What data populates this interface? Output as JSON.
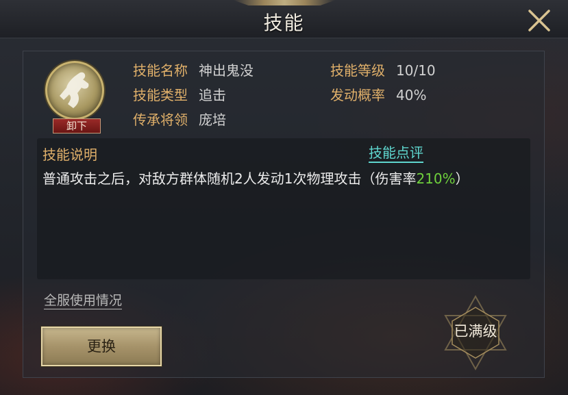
{
  "window": {
    "title": "技能"
  },
  "skill": {
    "unequip_label": "卸下",
    "name_label": "技能名称",
    "name_value": "神出鬼没",
    "type_label": "技能类型",
    "type_value": "追击",
    "inherit_label": "传承将领",
    "inherit_value": "庞培",
    "level_label": "技能等级",
    "level_value": "10/10",
    "rate_label": "发动概率",
    "rate_value": "40%"
  },
  "description": {
    "title": "技能说明",
    "review_link": "技能点评",
    "text_main": "普通攻击之后，对敌方群体随机2人发动1次物理攻击（伤害率",
    "text_pct": "210%",
    "text_end": "）"
  },
  "footer": {
    "server_usage": "全服使用情况",
    "replace_button": "更换",
    "maxed_label": "已满级"
  },
  "colors": {
    "label_gold": "#e0b06a",
    "link_cyan": "#5fd7cf",
    "highlight_green": "#6fd13c"
  }
}
